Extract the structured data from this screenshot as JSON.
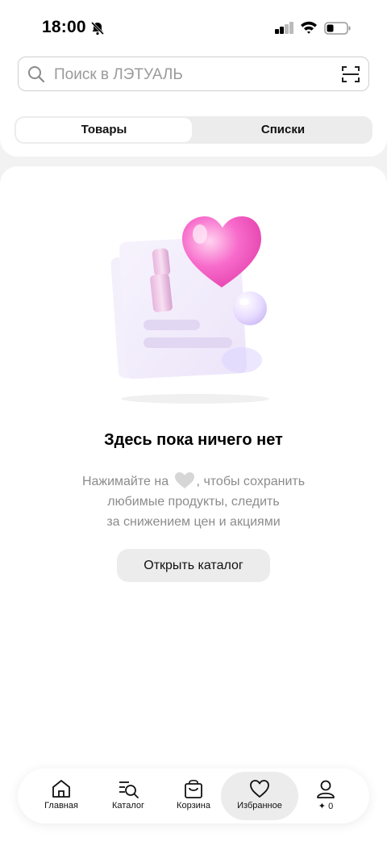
{
  "status_bar": {
    "time": "18:00"
  },
  "search": {
    "placeholder": "Поиск в ЛЭТУАЛЬ"
  },
  "tabs": [
    {
      "label": "Товары",
      "active": true
    },
    {
      "label": "Списки",
      "active": false
    }
  ],
  "empty_state": {
    "title": "Здесь пока ничего нет",
    "desc_before_icon": "Нажимайте на",
    "desc_after_icon": ", чтобы сохранить",
    "desc_line2": "любимые продукты, следить",
    "desc_line3": "за снижением цен и акциями",
    "button_label": "Открыть каталог"
  },
  "bottom_nav": {
    "items": [
      {
        "label": "Главная",
        "icon": "home-icon"
      },
      {
        "label": "Каталог",
        "icon": "catalog-search-icon"
      },
      {
        "label": "Корзина",
        "icon": "bag-icon"
      },
      {
        "label": "Избранное",
        "icon": "heart-icon",
        "active": true
      },
      {
        "label": "✦ 0",
        "icon": "profile-icon"
      }
    ]
  },
  "colors": {
    "background": "#f2f2f2",
    "card": "#ffffff",
    "muted_text": "#8c8c8c",
    "pill": "#ececec",
    "heart_pink": "#f36bc4"
  }
}
